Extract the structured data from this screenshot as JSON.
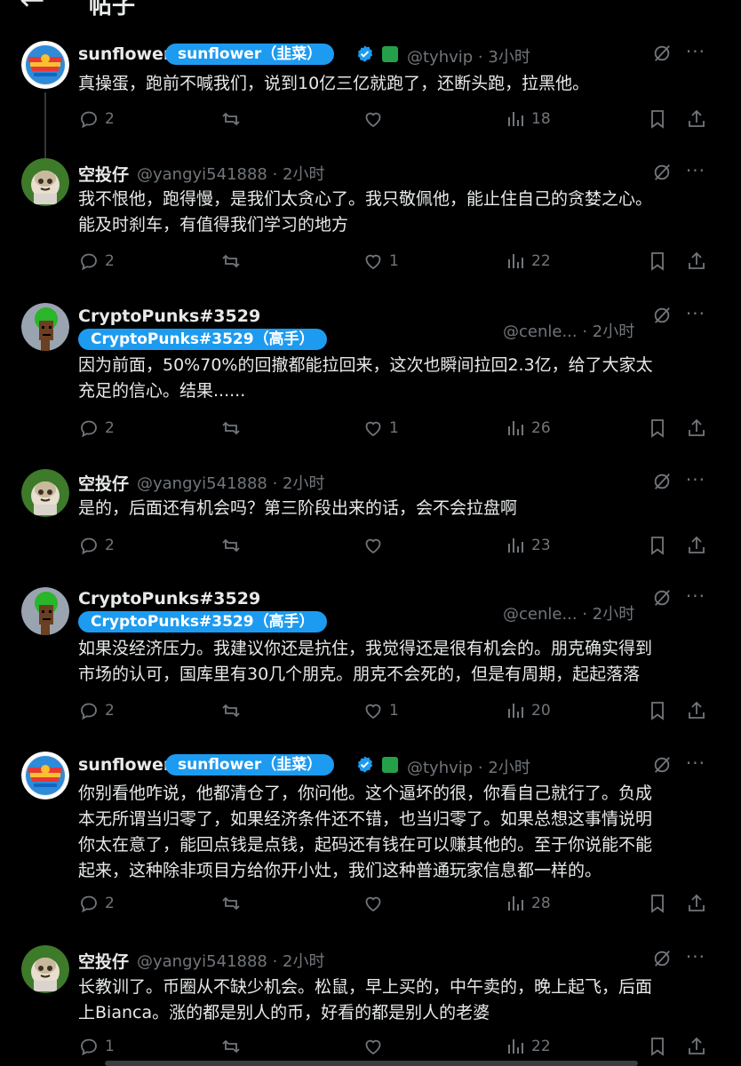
{
  "header": {
    "back_icon": "arrow-left-icon",
    "title": "帖子"
  },
  "colors": {
    "background": "#000000",
    "text": "#e7e9ea",
    "muted": "#71767b",
    "accent": "#1d9bf0",
    "line": "#333639"
  },
  "posts": [
    {
      "name": "sunflower",
      "badge": "sunflower（韭菜）",
      "verified": true,
      "square_badge": true,
      "handle": "@tyhvip · 3小时",
      "lines": [
        "真操蛋，跑前不喊我们，说到10亿三亿就跑了，还断头跑，拉黑他。"
      ],
      "replies": "2",
      "reposts": "",
      "likes": "",
      "views": "18"
    },
    {
      "name": "空投仔",
      "handle": "@yangyi541888 · 2小时",
      "lines": [
        "我不恨他，跑得慢，是我们太贪心了。我只敬佩他，能止住自己的贪婪之心。",
        "能及时刹车，有值得我们学习的地方"
      ],
      "replies": "2",
      "reposts": "",
      "likes": "1",
      "views": "22"
    },
    {
      "name": "CryptoPunks#3529",
      "badge": "CryptoPunks#3529（高手）",
      "handle": "@cenle... · 2小时",
      "lines": [
        "因为前面，50%70%的回撤都能拉回来，这次也瞬间拉回2.3亿，给了大家太",
        "充足的信心。结果......"
      ],
      "replies": "2",
      "reposts": "",
      "likes": "1",
      "views": "26"
    },
    {
      "name": "空投仔",
      "handle": "@yangyi541888 · 2小时",
      "lines": [
        "是的，后面还有机会吗？第三阶段出来的话，会不会拉盘啊"
      ],
      "replies": "2",
      "reposts": "",
      "likes": "",
      "views": "23"
    },
    {
      "name": "CryptoPunks#3529",
      "badge": "CryptoPunks#3529（高手）",
      "handle": "@cenle... · 2小时",
      "lines": [
        "如果没经济压力。我建议你还是抗住，我觉得还是很有机会的。朋克确实得到",
        "市场的认可，国库里有30几个朋克。朋克不会死的，但是有周期，起起落落"
      ],
      "replies": "2",
      "reposts": "",
      "likes": "1",
      "views": "20"
    },
    {
      "name": "sunflower",
      "badge": "sunflower（韭菜）",
      "verified": true,
      "square_badge": true,
      "handle": "@tyhvip · 2小时",
      "lines": [
        "你别看他咋说，他都清仓了，你问他。这个逼坏的很，你看自己就行了。负成",
        "本无所谓当归零了，如果经济条件还不错，也当归零了。如果总想这事情说明",
        "你太在意了，能回点钱是点钱，起码还有钱在可以赚其他的。至于你说能不能",
        "起来，这种除非项目方给你开小灶，我们这种普通玩家信息都一样的。"
      ],
      "replies": "2",
      "reposts": "",
      "likes": "",
      "views": "28"
    },
    {
      "name": "空投仔",
      "handle": "@yangyi541888 · 2小时",
      "lines": [
        "长教训了。币圈从不缺少机会。松鼠，早上买的，中午卖的，晚上起飞，后面",
        "上Bianca。涨的都是别人的币，好看的都是别人的老婆"
      ],
      "replies": "1",
      "reposts": "",
      "likes": "",
      "views": "22"
    }
  ]
}
